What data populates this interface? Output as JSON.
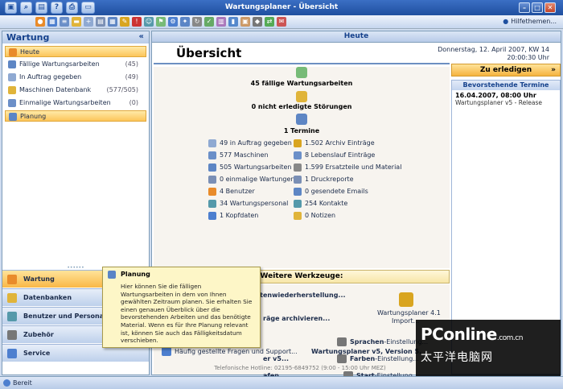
{
  "window": {
    "title": "Wartungsplaner - Übersicht",
    "help": "Hilfethemen..."
  },
  "toolbar_icons": [
    "home-icon",
    "calendar-icon",
    "list-icon",
    "folder-icon",
    "new-icon",
    "print-icon",
    "save-icon",
    "settings-icon",
    "warning-icon",
    "users-icon",
    "flag-icon",
    "refresh-icon",
    "tools-icon",
    "mail-icon"
  ],
  "left": {
    "header": "Wartung",
    "collapse": "«",
    "items": [
      {
        "label": "Heute",
        "count": ""
      },
      {
        "label": "Fällige Wartungsarbeiten",
        "count": "(45)"
      },
      {
        "label": "In Auftrag gegeben",
        "count": "(49)"
      },
      {
        "label": "Maschinen Datenbank",
        "count": "(577/505)"
      },
      {
        "label": "Einmalige Wartungsarbeiten",
        "count": "(0)"
      },
      {
        "label": "Planung",
        "count": ""
      }
    ],
    "nav_buttons": [
      "Wartung",
      "Datenbanken",
      "Benutzer und Personal",
      "Zubehör",
      "Service"
    ]
  },
  "main": {
    "header": "Heute",
    "title": "Übersicht",
    "date_line1": "Donnerstag, 12. April 2007, KW 14",
    "date_line2": "20:00:30 Uhr",
    "due_work": "45 fällige Wartungsarbeiten",
    "open_faults": "0 nicht erledigte Störungen",
    "appointments": "1 Termine",
    "stats_left": [
      "49 in Auftrag gegeben",
      "577 Maschinen",
      "505 Wartungsarbeiten",
      "0 einmalige Wartungen",
      "4 Benutzer",
      "34 Wartungspersonal",
      "1 Kopfdaten"
    ],
    "stats_right": [
      "1.502 Archiv Einträge",
      "8 Lebenslauf Einträge",
      "1.599 Ersatzteile und Material",
      "1 Druckreporte",
      "0 gesendete Emails",
      "254 Kontakte",
      "0 Notizen"
    ],
    "tools_header": "Weitere Werkzeuge:",
    "tools": {
      "backup": "Datensicherung und Datenwiederherstellung...",
      "archive": "räge archivieren...",
      "version_box": "Wartungsplaner 4.1",
      "version_box2": "Import...",
      "lang": "Sprachen",
      "lang_suffix": "-Einstellung...",
      "colors": "Farben",
      "colors_suffix": "-Einstellung...",
      "start": "Start",
      "start_suffix": "-Einstellung...",
      "partial1": "er v5...",
      "partial2": "afen...",
      "faq": "Häufig gestellte Fragen und Support...",
      "version": "Wartungsplaner v5, Version 5.",
      "hotline": "Telefonische Hotline: 02195-6849752 (9:00 - 15:00 Uhr MEZ)"
    }
  },
  "right": {
    "button": "Zu erledigen",
    "arrow": "»",
    "header": "Bevorstehende Termine",
    "term_date": "16.04.2007, 08:00 Uhr",
    "term_text": "Wartungsplaner v5 - Release"
  },
  "tooltip": {
    "title": "Planung",
    "body": "Hier können Sie die fälligen Wartungsarbeiten in dem von Ihnen gewählten Zeitraum planen. Sie erhalten Sie einen genauen Überblick über die bevorstehenden Arbeiten und das benötigte Material. Wenn es für Ihre Planung relevant ist, können Sie auch das Fälligkeitsdatum verschieben."
  },
  "status": "Bereit",
  "watermark": {
    "brand": "PConline",
    "domain": ".com.cn",
    "cn": "太平洋电脑网"
  },
  "colors": {
    "accent": "#1f4f9f",
    "selection": "#fcc55a"
  }
}
